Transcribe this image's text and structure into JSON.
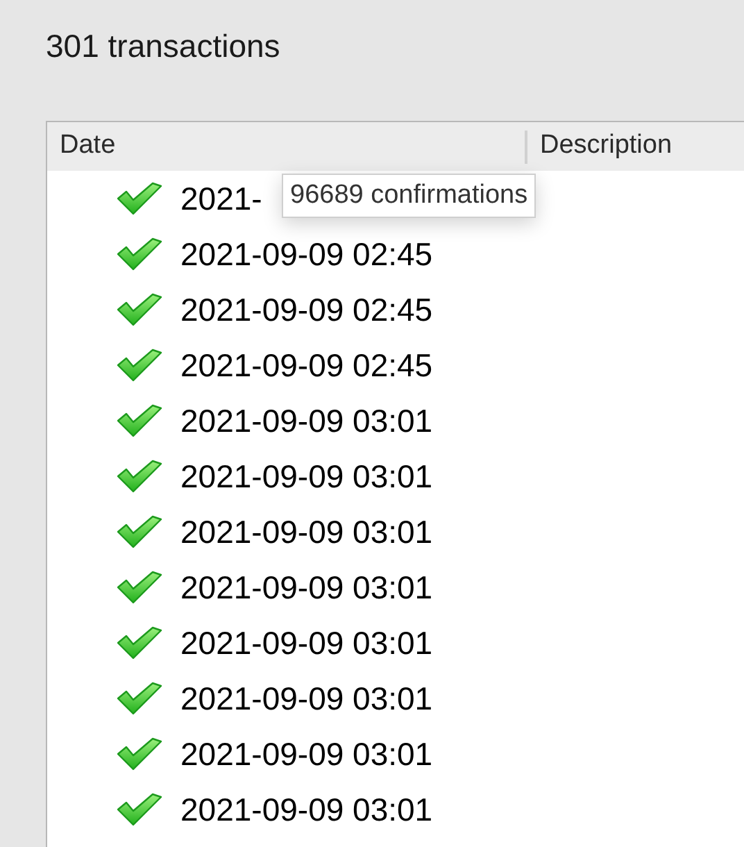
{
  "heading": "301 transactions",
  "table": {
    "columns": [
      "Date",
      "Description"
    ],
    "rows": [
      {
        "confirmed": true,
        "date": "2021-"
      },
      {
        "confirmed": true,
        "date": "2021-09-09 02:45"
      },
      {
        "confirmed": true,
        "date": "2021-09-09 02:45"
      },
      {
        "confirmed": true,
        "date": "2021-09-09 02:45"
      },
      {
        "confirmed": true,
        "date": "2021-09-09 03:01"
      },
      {
        "confirmed": true,
        "date": "2021-09-09 03:01"
      },
      {
        "confirmed": true,
        "date": "2021-09-09 03:01"
      },
      {
        "confirmed": true,
        "date": "2021-09-09 03:01"
      },
      {
        "confirmed": true,
        "date": "2021-09-09 03:01"
      },
      {
        "confirmed": true,
        "date": "2021-09-09 03:01"
      },
      {
        "confirmed": true,
        "date": "2021-09-09 03:01"
      },
      {
        "confirmed": true,
        "date": "2021-09-09 03:01"
      }
    ]
  },
  "tooltip": {
    "text": "96689 confirmations"
  }
}
